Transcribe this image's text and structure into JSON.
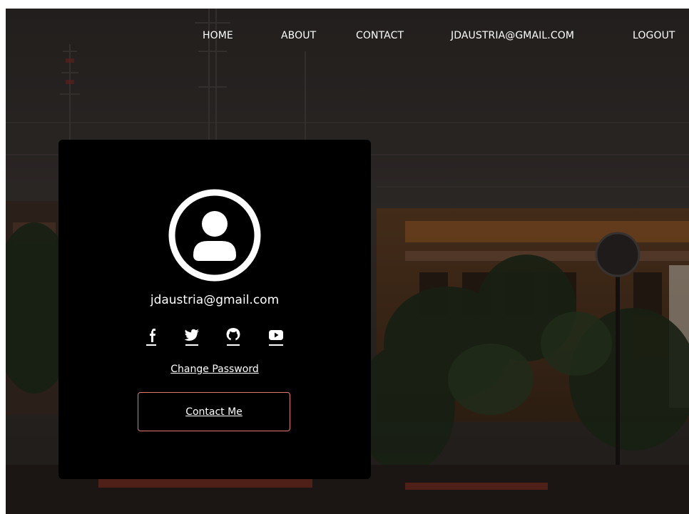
{
  "nav": {
    "items": [
      {
        "label": "HOME"
      },
      {
        "label": "ABOUT"
      },
      {
        "label": "CONTACT"
      },
      {
        "label": "JDAUSTRIA@GMAIL.COM"
      },
      {
        "label": "LOGOUT"
      }
    ]
  },
  "profile": {
    "email": "jdaustria@gmail.com",
    "socials": [
      {
        "icon": "facebook-icon"
      },
      {
        "icon": "twitter-icon"
      },
      {
        "icon": "github-icon"
      },
      {
        "icon": "youtube-icon"
      }
    ],
    "change_password_label": "Change Password",
    "contact_button_label": "Contact Me"
  },
  "colors": {
    "card_background": "#000000",
    "text": "#ffffff",
    "contact_border": "#e07a6c"
  }
}
